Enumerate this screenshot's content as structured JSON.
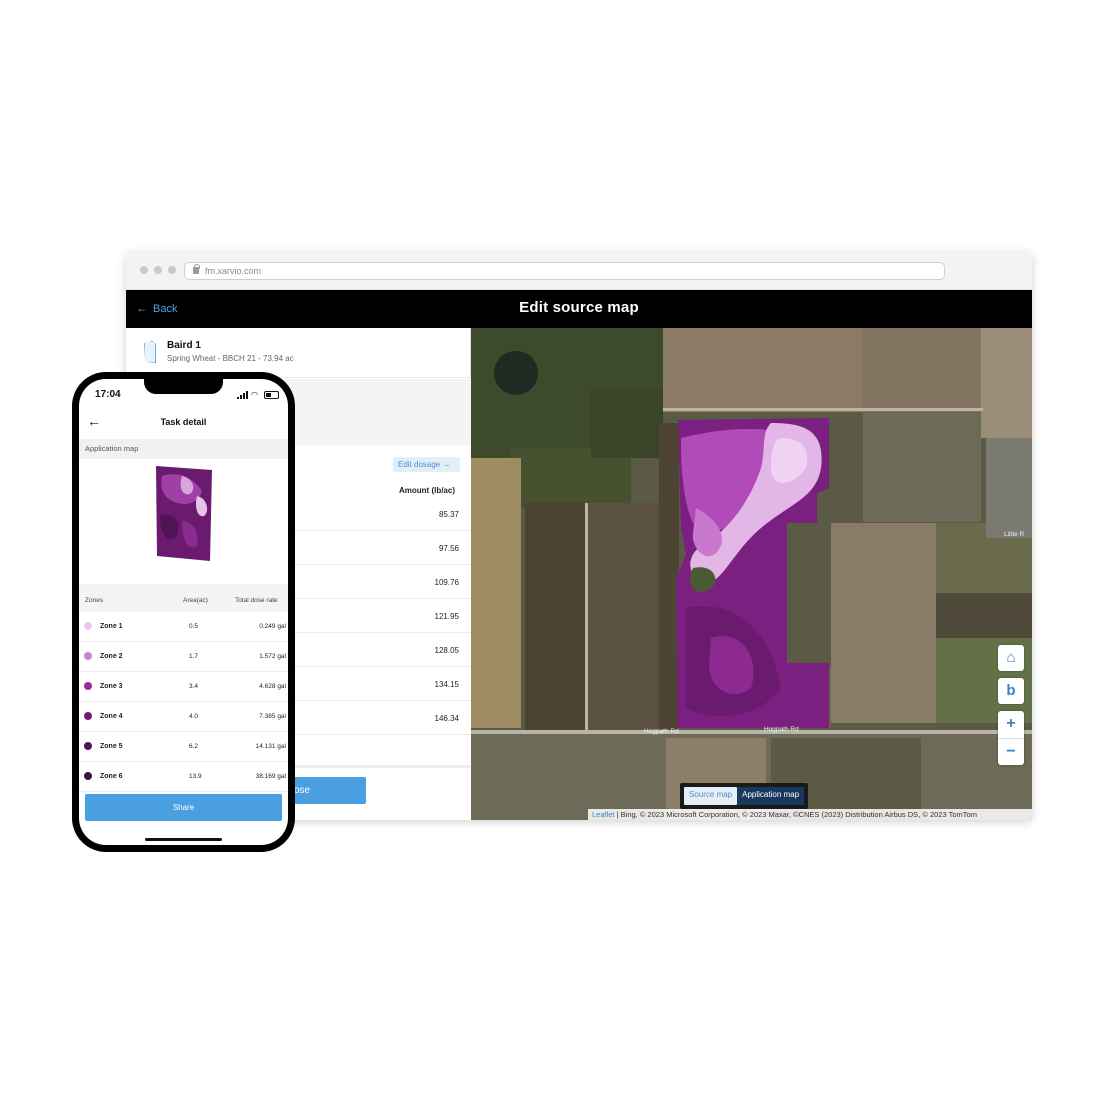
{
  "browser": {
    "url": "fm.xarvio.com",
    "back_label": "Back",
    "title": "Edit source map"
  },
  "field": {
    "name": "Baird 1",
    "subtitle": "Spring Wheat - BBCH 21 - 73.94 ac"
  },
  "dosage": {
    "edit_label": "Edit dosage",
    "amount_header": "Amount (lb/ac)",
    "amounts": [
      "85.37",
      "97.56",
      "109.76",
      "121.95",
      "128.05",
      "134.15",
      "146.34"
    ],
    "primary_button_partial": "ose"
  },
  "map": {
    "toggle_source": "Source map",
    "toggle_application": "Application map",
    "attribution_link": "Leaflet",
    "attribution_text": " | Bing, © 2023 Microsoft Corporation, © 2023 Maxar, ©CNES (2023) Distribution Airbus DS, © 2023 TomTom",
    "road_label_1": "Hogpath Rd",
    "road_label_2": "Hogpath Rd",
    "town_label": "Little R",
    "zoom_in": "+",
    "zoom_out": "−",
    "colors": {
      "zone_light": "#e2b6e6",
      "zone_mid": "#b04bb8",
      "zone_dark": "#7b1f80",
      "zone_deep": "#5e1462"
    }
  },
  "phone": {
    "time": "17:04",
    "title": "Task detail",
    "section_label": "Application map",
    "zones_header": {
      "zones": "Zones",
      "area": "Area(ac)",
      "dose": "Total dose rate"
    },
    "zones": [
      {
        "name": "Zone 1",
        "area": "0.5",
        "dose": "0.249 gal",
        "color": "#e7c8ea"
      },
      {
        "name": "Zone 2",
        "area": "1.7",
        "dose": "1.572 gal",
        "color": "#c984cf"
      },
      {
        "name": "Zone 3",
        "area": "3.4",
        "dose": "4.628 gal",
        "color": "#932a98"
      },
      {
        "name": "Zone 4",
        "area": "4.0",
        "dose": "7.385 gal",
        "color": "#6e1a72"
      },
      {
        "name": "Zone 5",
        "area": "6.2",
        "dose": "14.131 gal",
        "color": "#4f1454"
      },
      {
        "name": "Zone 6",
        "area": "13.9",
        "dose": "38.169 gal",
        "color": "#3b0f3f"
      }
    ],
    "share_label": "Share"
  }
}
